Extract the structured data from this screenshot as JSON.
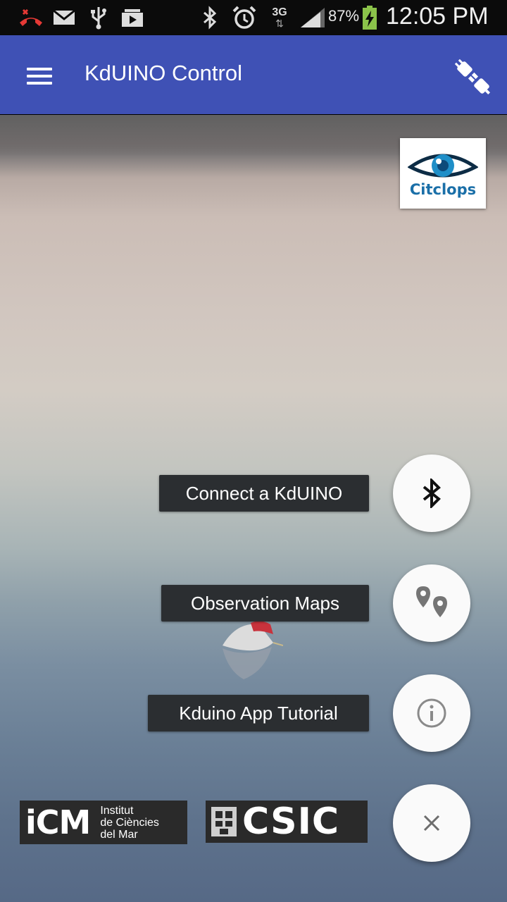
{
  "status_bar": {
    "battery_percent": "87%",
    "network_type": "3G",
    "time": "12:05 PM",
    "icons": [
      "missed-call-icon",
      "email-icon",
      "usb-icon",
      "media-icon",
      "bluetooth-icon",
      "alarm-icon",
      "network-3g-icon",
      "signal-icon",
      "battery-charging-icon"
    ]
  },
  "app_bar": {
    "title": "KdUINO Control",
    "color": "#3f51b5"
  },
  "logos": {
    "citclops": "Citclops",
    "icm_big": "iCM",
    "icm_line1": "Institut",
    "icm_line2": "de Ciències",
    "icm_line3": "del Mar",
    "csic": "CSIC"
  },
  "fab_menu": {
    "items": [
      {
        "label": "Connect a KdUINO",
        "icon": "bluetooth-icon"
      },
      {
        "label": "Observation Maps",
        "icon": "map-pins-icon"
      },
      {
        "label": "Kduino App Tutorial",
        "icon": "info-icon"
      }
    ],
    "close_icon": "close-icon"
  }
}
